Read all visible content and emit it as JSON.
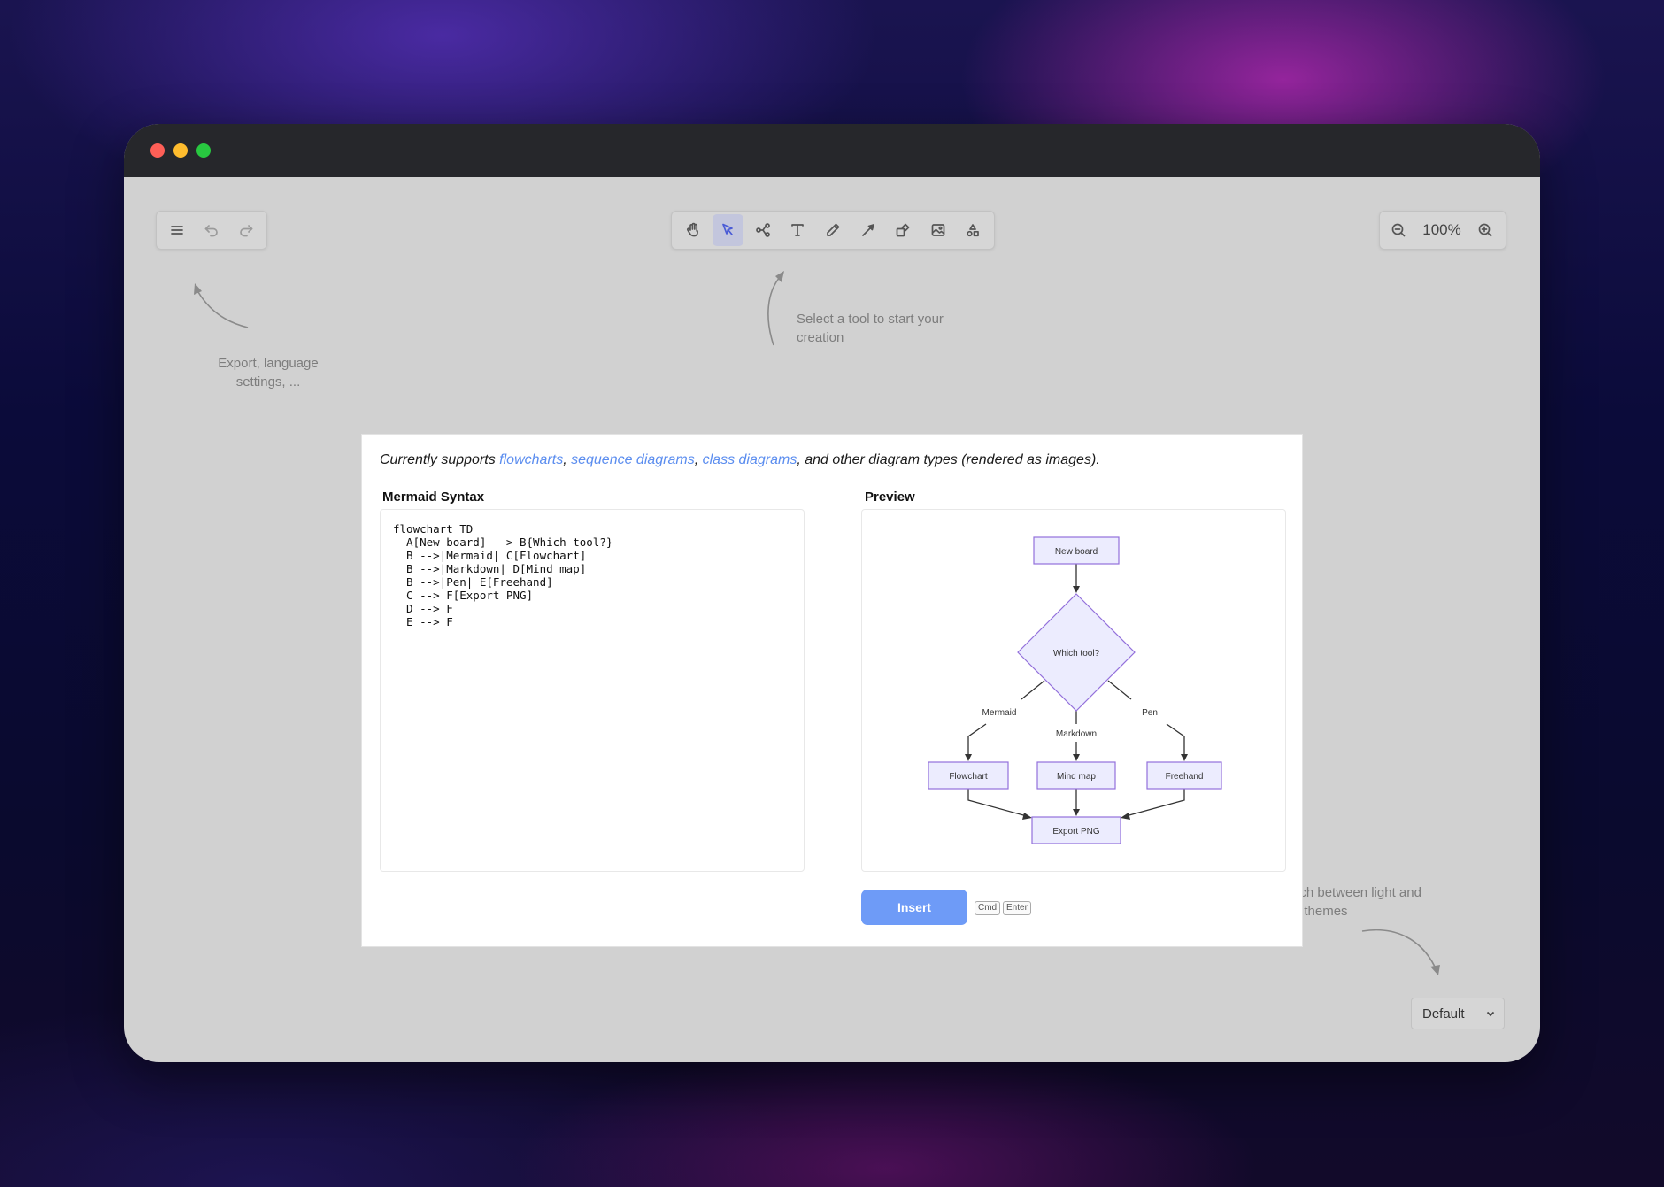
{
  "toolbar": {
    "zoom_level": "100%",
    "tools": [
      "hand-icon",
      "select-icon",
      "mind-map-icon",
      "text-icon",
      "pen-icon",
      "arrow-icon",
      "shapes-icon",
      "image-icon",
      "more-icon"
    ],
    "active_tool": "select-icon"
  },
  "hints": {
    "menu": "Export, language settings, ...",
    "tools": "Select a tool to start your creation",
    "theme": "Switch between light and dark themes"
  },
  "dialog": {
    "intro_prefix": "Currently supports ",
    "link_flowcharts": "flowcharts",
    "sep1": ", ",
    "link_sequence": "sequence diagrams",
    "sep2": ", ",
    "link_class": "class diagrams",
    "intro_suffix": ", and other diagram types (rendered as images).",
    "syntax_label": "Mermaid Syntax",
    "preview_label": "Preview",
    "code": "flowchart TD\n  A[New board] --> B{Which tool?}\n  B -->|Mermaid| C[Flowchart]\n  B -->|Markdown| D[Mind map]\n  B -->|Pen| E[Freehand]\n  C --> F[Export PNG]\n  D --> F\n  E --> F",
    "insert_label": "Insert",
    "shortcut_key1": "Cmd",
    "shortcut_key2": "Enter"
  },
  "preview": {
    "node_a": "New board",
    "node_b": "Which tool?",
    "node_c": "Flowchart",
    "node_d": "Mind map",
    "node_e": "Freehand",
    "node_f": "Export PNG",
    "edge_mermaid": "Mermaid",
    "edge_markdown": "Markdown",
    "edge_pen": "Pen"
  },
  "theme_select": {
    "value": "Default"
  },
  "colors": {
    "accent": "#6e9bf7",
    "link": "#5b8def",
    "node_fill": "#ececfe",
    "node_stroke": "#9370db"
  }
}
